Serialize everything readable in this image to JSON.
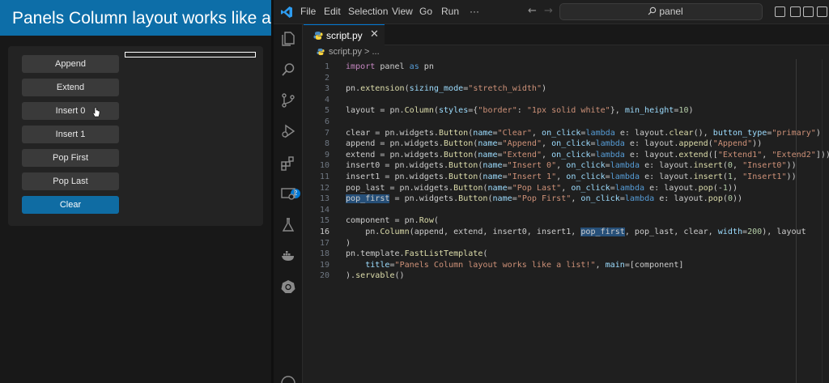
{
  "panel_app": {
    "title": "Panels Column layout works like a list!",
    "buttons": [
      {
        "label": "Append"
      },
      {
        "label": "Extend"
      },
      {
        "label": "Insert 0"
      },
      {
        "label": "Insert 1"
      },
      {
        "label": "Pop First"
      },
      {
        "label": "Pop Last"
      },
      {
        "label": "Clear"
      }
    ]
  },
  "vscode": {
    "menu": [
      "File",
      "Edit",
      "Selection",
      "View",
      "Go",
      "Run",
      "···"
    ],
    "search_text": "panel",
    "tab_label": "script.py",
    "breadcrumb": "script.py > ...",
    "extensions_badge": "2",
    "active_line": 16,
    "code_lines": [
      "import panel as pn",
      "",
      "pn.extension(sizing_mode=\"stretch_width\")",
      "",
      "layout = pn.Column(styles={\"border\": \"1px solid white\"}, min_height=10)",
      "",
      "clear = pn.widgets.Button(name=\"Clear\", on_click=lambda e: layout.clear(), button_type=\"primary\")",
      "append = pn.widgets.Button(name=\"Append\", on_click=lambda e: layout.append(\"Append\"))",
      "extend = pn.widgets.Button(name=\"Extend\", on_click=lambda e: layout.extend([\"Extend1\", \"Extend2\"]))",
      "insert0 = pn.widgets.Button(name=\"Insert 0\", on_click=lambda e: layout.insert(0, \"Insert0\"))",
      "insert1 = pn.widgets.Button(name=\"Insert 1\", on_click=lambda e: layout.insert(1, \"Insert1\"))",
      "pop_last = pn.widgets.Button(name=\"Pop Last\", on_click=lambda e: layout.pop(-1))",
      "pop_first = pn.widgets.Button(name=\"Pop First\", on_click=lambda e: layout.pop(0))",
      "",
      "component = pn.Row(",
      "    pn.Column(append, extend, insert0, insert1, pop_first, pop_last, clear, width=200), layout",
      ")",
      "pn.template.FastListTemplate(",
      "    title=\"Panels Column layout works like a list!\", main=[component]",
      ").servable()"
    ]
  }
}
